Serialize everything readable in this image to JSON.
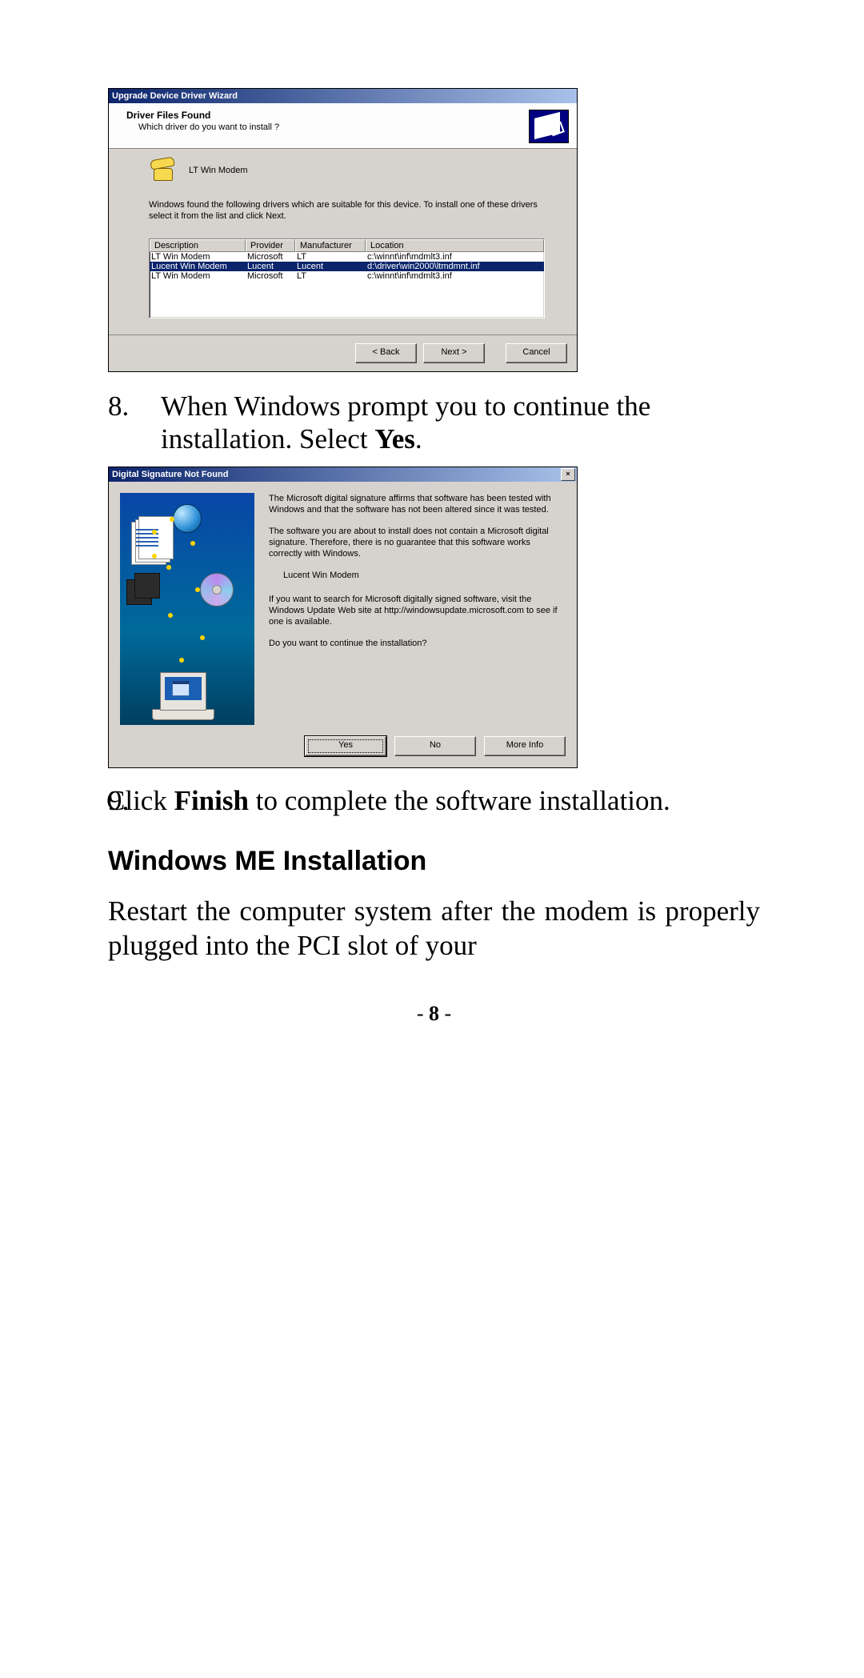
{
  "wizard": {
    "title": "Upgrade Device Driver Wizard",
    "header_title": "Driver Files Found",
    "header_sub": "Which driver do you want to install ?",
    "device_name": "LT Win Modem",
    "instruction": "Windows found the following drivers which are suitable for this device. To install one of these drivers select it from the list and click Next.",
    "columns": {
      "desc": "Description",
      "prov": "Provider",
      "mfr": "Manufacturer",
      "loc": "Location"
    },
    "rows": [
      {
        "desc": "LT Win Modem",
        "prov": "Microsoft",
        "mfr": "LT",
        "loc": "c:\\winnt\\inf\\mdmlt3.inf",
        "selected": false
      },
      {
        "desc": "Lucent Win Modem",
        "prov": "Lucent",
        "mfr": "Lucent",
        "loc": "d:\\driver\\win2000\\ltmdmnt.inf",
        "selected": true
      },
      {
        "desc": "LT Win Modem",
        "prov": "Microsoft",
        "mfr": "LT",
        "loc": "c:\\winnt\\inf\\mdmlt3.inf",
        "selected": false
      }
    ],
    "btn_back": "< Back",
    "btn_next": "Next >",
    "btn_cancel": "Cancel"
  },
  "steps": {
    "s8_num": "8.",
    "s8_a": "When Windows prompt you to continue the installation.  Select ",
    "s8_b": "Yes",
    "s8_c": ".",
    "s9_num": "9.",
    "s9_a": "  Click ",
    "s9_b": "Finish",
    "s9_c": " to complete the software installation."
  },
  "sig": {
    "title": "Digital Signature Not Found",
    "close": "×",
    "p1": "The Microsoft digital signature affirms that software has been tested with Windows and that the software has not been altered since it was tested.",
    "p2": "The software you are about to install does not contain a Microsoft digital signature. Therefore,  there is no guarantee that this software works correctly with Windows.",
    "device": "Lucent Win Modem",
    "p3": "If you want to search for Microsoft digitally signed software, visit the Windows Update Web site at http://windowsupdate.microsoft.com to see if one is available.",
    "p4": "Do you want to continue the installation?",
    "btn_yes": "Yes",
    "btn_no": "No",
    "btn_more": "More Info"
  },
  "section_heading": "Windows ME Installation",
  "body_para": "Restart the computer system after the modem is properly plugged into the PCI slot of your",
  "page_number": "8"
}
